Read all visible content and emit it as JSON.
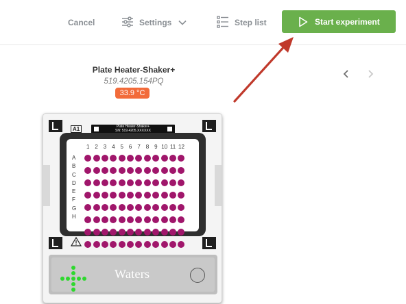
{
  "toolbar": {
    "cancel_label": "Cancel",
    "settings_label": "Settings",
    "steplist_label": "Step list",
    "start_label": "Start experiment"
  },
  "device": {
    "name": "Plate Heater-Shaker+",
    "serial": "519.4205.154PQ",
    "temperature": "33.9 °C",
    "position_label": "A1",
    "label_line1": "Plate Heater-Shaker+",
    "label_line2": "SN: 519.4205.XXXXXX",
    "brand_logo": "Waters",
    "plate": {
      "columns": [
        "1",
        "2",
        "3",
        "4",
        "5",
        "6",
        "7",
        "8",
        "9",
        "10",
        "11",
        "12"
      ],
      "rows": [
        "A",
        "B",
        "C",
        "D",
        "E",
        "F",
        "G",
        "H"
      ],
      "well_color": "#a0166b"
    }
  },
  "colors": {
    "accent": "#6ab04c",
    "temperature_badge": "#f26b3a",
    "annotation_arrow": "#c0392b",
    "status_led": "#2dd82d"
  },
  "icons": {
    "settings": "sliders-icon",
    "settings_dropdown": "chevron-down-icon",
    "steplist": "list-icon",
    "start": "play-icon",
    "prev": "chevron-left-icon",
    "next": "chevron-right-icon"
  }
}
